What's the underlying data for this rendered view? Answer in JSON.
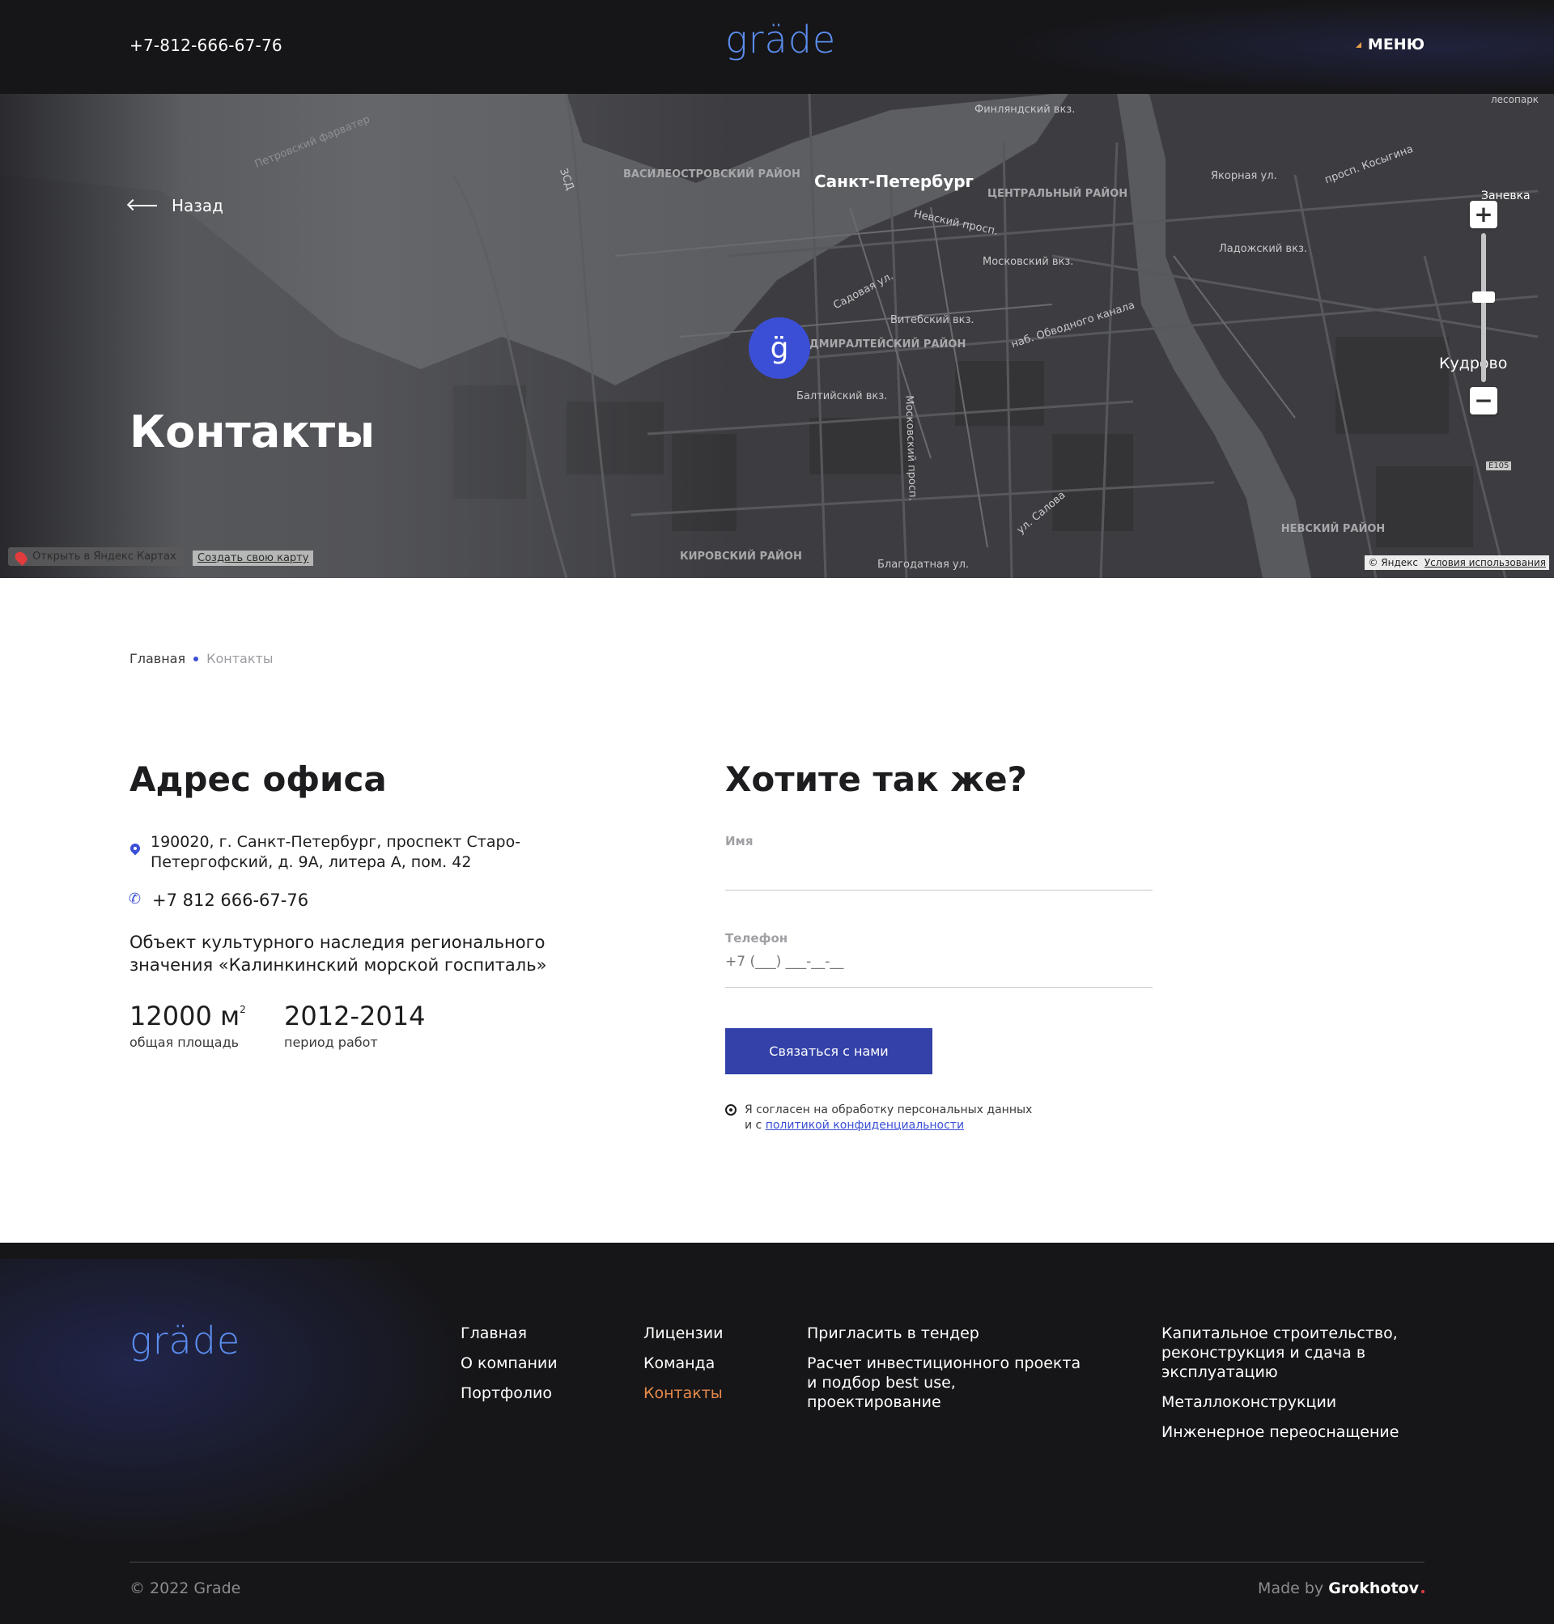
{
  "header": {
    "phone": "+7-812-666-67-76",
    "logo": "gräde",
    "menu_label": "МЕНЮ"
  },
  "hero": {
    "back_label": "Назад",
    "title": "Контакты",
    "pin_letter": "g̈",
    "map_labels": {
      "city": "Санкт-Петербург",
      "vasileostrovsky": "ВАСИЛЕОСТРОВСКИЙ РАЙОН",
      "central": "ЦЕНТРАЛЬНЫЙ РАЙОН",
      "admiralteysky": "АДМИРАЛТЕЙСКИЙ РАЙОН",
      "kirovsky": "КИРОВСКИЙ РАЙОН",
      "nevsky": "НЕВСКИЙ РАЙОН",
      "finlyandsky": "Финляндский вкз.",
      "moskovsky": "Московский вкз.",
      "vitebsky": "Витебский вкз.",
      "baltiysky": "Балтийский вкз.",
      "ladozhsky": "Ладожский вкз.",
      "nevsky_prosp": "Невский просп.",
      "sadovaya": "Садовая ул.",
      "obvodny": "наб. Обводного канала",
      "yakornaya": "Якорная ул.",
      "kosygina": "просп. Косыгина",
      "zanevka": "Заневка",
      "kudrovo": "Кудрово",
      "lesoparki": "лесопарк",
      "zsd": "ЗСД",
      "fairway": "Петровский фарватер",
      "blagodatnaya": "Благодатная ул.",
      "moskovsky_prosp": "Московский просп.",
      "salova": "ул. Салова",
      "e105": "E105"
    },
    "open_in_maps": "Открыть в Яндекс Картах",
    "create_map": "Создать свою карту",
    "copyright": "© Яндекс",
    "terms": "Условия использования"
  },
  "breadcrumb": {
    "home": "Главная",
    "current": "Контакты"
  },
  "office": {
    "title": "Адрес офиса",
    "address_line1": "190020, г. Санкт-Петербург, проспект Старо-",
    "address_line2": "Петергофский, д. 9А, литера А, пом. 42",
    "phone": "+7 812 666-67-76",
    "heritage": "Объект культурного наследия регионального значения «Калинкинский морской госпиталь»",
    "stats": [
      {
        "value": "12000 м",
        "sup": "2",
        "label": "общая площадь"
      },
      {
        "value": "2012-2014",
        "sup": "",
        "label": "период работ"
      }
    ]
  },
  "form": {
    "title": "Хотите так же?",
    "name_label": "Имя",
    "name_value": "",
    "phone_label": "Телефон",
    "phone_placeholder": "+7 (___) ___-__-__",
    "submit_label": "Связаться с нами",
    "consent_text": "Я согласен на обработку персональных данных",
    "consent_and": "и с",
    "consent_link": "политикой конфиденциальности"
  },
  "footer": {
    "logo": "gräde",
    "col1": [
      "Главная",
      "О компании",
      "Портфолио"
    ],
    "col2": [
      "Лицензии",
      "Команда",
      "Контакты"
    ],
    "col3": [
      "Пригласить в тендер",
      "Расчет инвестиционного проекта и подбор best use, проектирование"
    ],
    "col4": [
      "Капитальное строительство, реконструкция и сдача в эксплуатацию",
      "Металлоконструкции",
      "Инженерное переоснащение"
    ],
    "active_color": "#e78a4a",
    "copyright": "© 2022 Grade",
    "made_by_prefix": "Made by",
    "made_by_name": "Grokhotov"
  }
}
